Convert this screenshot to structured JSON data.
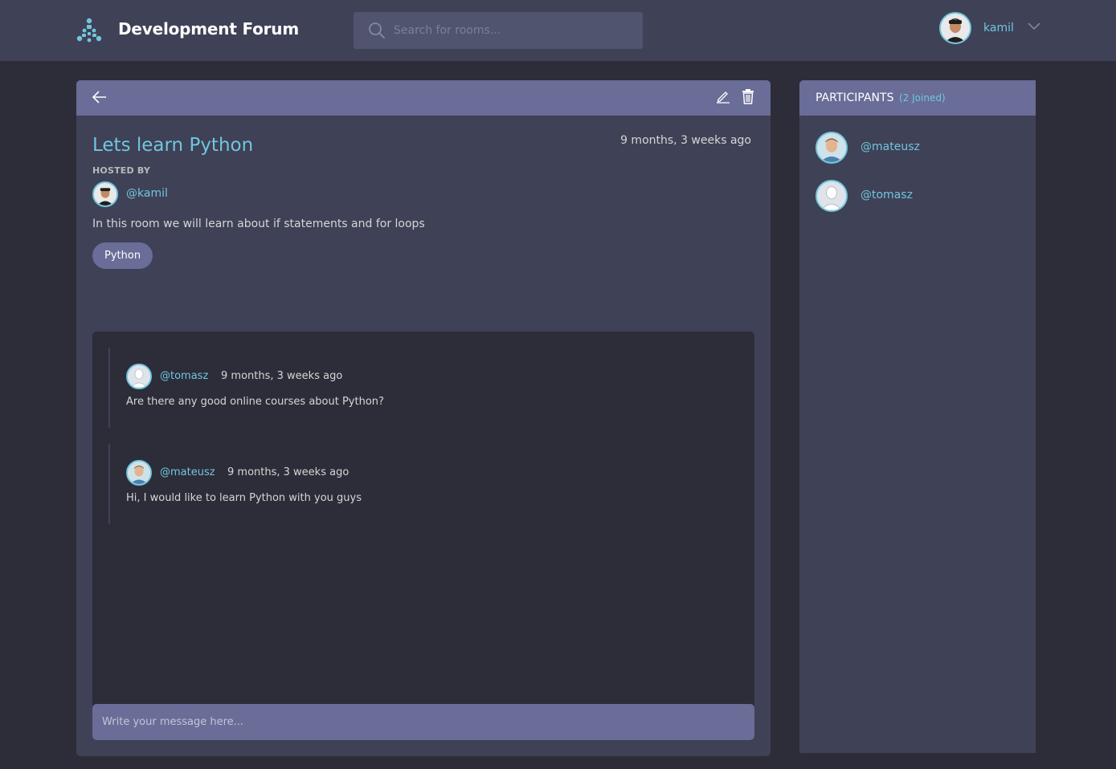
{
  "header": {
    "brand": "Development Forum",
    "search_placeholder": "Search for rooms...",
    "user_name": "kamil"
  },
  "room": {
    "title": "Lets learn Python",
    "created": "9 months, 3 weeks ago",
    "hosted_by_label": "HOSTED BY",
    "host": "@kamil",
    "description": "In this room we will learn about if statements and for loops",
    "topic": "Python",
    "message_placeholder": "Write your message here..."
  },
  "messages": [
    {
      "author": "@tomasz",
      "time": "9 months, 3 weeks ago",
      "body": "Are there any good online courses about Python?"
    },
    {
      "author": "@mateusz",
      "time": "9 months, 3 weeks ago",
      "body": "Hi, I would like to learn Python with you guys"
    }
  ],
  "participants": {
    "title": "PARTICIPANTS",
    "count": "(2 Joined)",
    "list": [
      {
        "name": "@mateusz"
      },
      {
        "name": "@tomasz"
      }
    ]
  },
  "colors": {
    "background": "#2d2d39",
    "panel": "#3f4156",
    "accent_bar": "#696d97",
    "link": "#71c6dd"
  }
}
